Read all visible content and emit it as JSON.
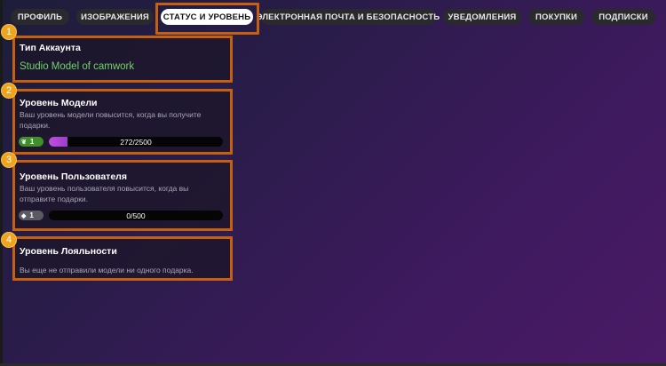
{
  "tabs": [
    {
      "label": "ПРОФИЛЬ",
      "active": false
    },
    {
      "label": "ИЗОБРАЖЕНИЯ",
      "active": false
    },
    {
      "label": "СТАТУС И УРОВЕНЬ",
      "active": true
    },
    {
      "label": "ЭЛЕКТРОННАЯ ПОЧТА И БЕЗОПАСНОСТЬ",
      "active": false
    },
    {
      "label": "УВЕДОМЛЕНИЯ",
      "active": false
    },
    {
      "label": "ПОКУПКИ",
      "active": false
    },
    {
      "label": "ПОДПИСКИ",
      "active": false
    }
  ],
  "markers": [
    "1",
    "2",
    "3",
    "4"
  ],
  "account": {
    "title": "Тип Аккаунта",
    "value": "Studio Model of camwork"
  },
  "model_level": {
    "title": "Уровень Модели",
    "description": "Ваш уровень модели повысится, когда вы получите подарки.",
    "level": "1",
    "progress_text": "272/2500",
    "progress_fraction": 0.1088
  },
  "user_level": {
    "title": "Уровень Пользователя",
    "description": "Ваш уровень пользователя повысится, когда вы отправите подарки.",
    "level": "1",
    "progress_text": "0/500",
    "progress_fraction": 0
  },
  "loyalty": {
    "title": "Уровень Лояльности",
    "description": "Вы еще не отправили модели ни одного подарка."
  },
  "colors": {
    "accent_orange": "#c4600f",
    "marker_yellow": "#f0a31c",
    "account_green": "#6fd46a",
    "progress_purple": "#c24fe0"
  },
  "icons": {
    "model_level_badge": "sprout-icon",
    "user_level_badge": "diamond-icon"
  }
}
